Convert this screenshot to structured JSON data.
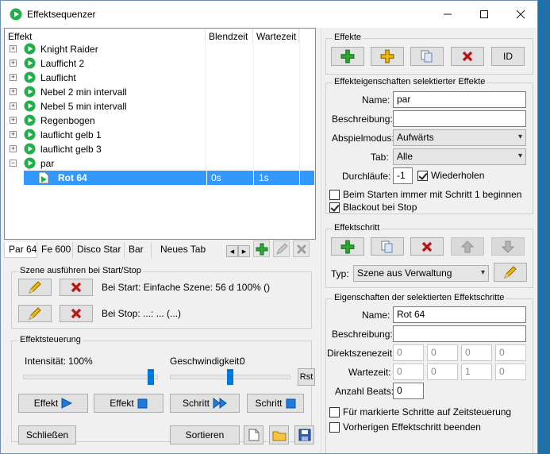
{
  "window": {
    "title": "Effektsequenzer"
  },
  "list": {
    "columns": [
      "Effekt",
      "Blendzeit",
      "Wartezeit"
    ],
    "items": [
      {
        "label": "Knight Raider"
      },
      {
        "label": "Laufficht 2"
      },
      {
        "label": "Lauflicht"
      },
      {
        "label": "Nebel 2 min intervall"
      },
      {
        "label": "Nebel 5 min intervall"
      },
      {
        "label": "Regenbogen"
      },
      {
        "label": "lauflicht gelb 1"
      },
      {
        "label": "lauflicht gelb 3"
      },
      {
        "label": "par"
      }
    ],
    "selected_child": {
      "label": "Rot 64",
      "blend": "0s",
      "wait": "1s"
    }
  },
  "tabs": [
    "Par 64",
    "Fe 600",
    "Disco Star",
    "Bar",
    "Neues Tab"
  ],
  "scene": {
    "legend": "Szene ausführen bei Start/Stop",
    "start_text": "Bei Start: Einfache Szene: 56 d 100% ()",
    "stop_text": "Bei Stop: ...: ... (...)"
  },
  "control": {
    "legend": "Effektsteuerung",
    "intensity_label": "Intensität:",
    "intensity_value": "100%",
    "intensity_level": 0.97,
    "speed_label": "Geschwindigkeit:",
    "speed_value": "0",
    "speed_level": 0.5,
    "rst_label": "Rst",
    "effect_play_label": "Effekt",
    "effect_stop_label": "Effekt",
    "step_next_label": "Schritt",
    "step_stop_label": "Schritt"
  },
  "bottom": {
    "close_label": "Schließen",
    "sort_label": "Sortieren"
  },
  "effects_box": {
    "legend": "Effekte",
    "id_label": "ID"
  },
  "props": {
    "legend": "Effekteigenschaften selektierter Effekte",
    "name_label": "Name:",
    "name_value": "par",
    "desc_label": "Beschreibung:",
    "desc_value": "",
    "mode_label": "Abspielmodus:",
    "mode_value": "Aufwärts",
    "tab_label": "Tab:",
    "tab_value": "Alle",
    "runs_label": "Durchläufe:",
    "runs_value": "-1",
    "repeat_label": "Wiederholen",
    "start_step1_label": "Beim Starten immer mit Schritt 1 beginnen",
    "blackout_label": "Blackout bei Stop"
  },
  "step_box": {
    "legend": "Effektschritt",
    "type_label": "Typ:",
    "type_value": "Szene aus Verwaltung"
  },
  "step_props": {
    "legend": "Eigenschaften der selektierten Effektschritte",
    "name_label": "Name:",
    "name_value": "Rot 64",
    "desc_label": "Beschreibung:",
    "desc_value": "",
    "direct_label": "Direktszenezeit:",
    "direct_values": [
      "0",
      "0",
      "0",
      "0"
    ],
    "wait_label": "Wartezeit:",
    "wait_values": [
      "0",
      "0",
      "1",
      "0"
    ],
    "beats_label": "Anzahl Beats:",
    "beats_value": "0",
    "time_ctrl_label": "Für markierte Schritte auf Zeitsteuerung",
    "end_prev_label": "Vorherigen Effektschritt beenden"
  },
  "colors": {
    "accent": "#0078d7",
    "play_green": "#22b04b",
    "delete_red": "#d02525",
    "selection": "#3399ff"
  }
}
